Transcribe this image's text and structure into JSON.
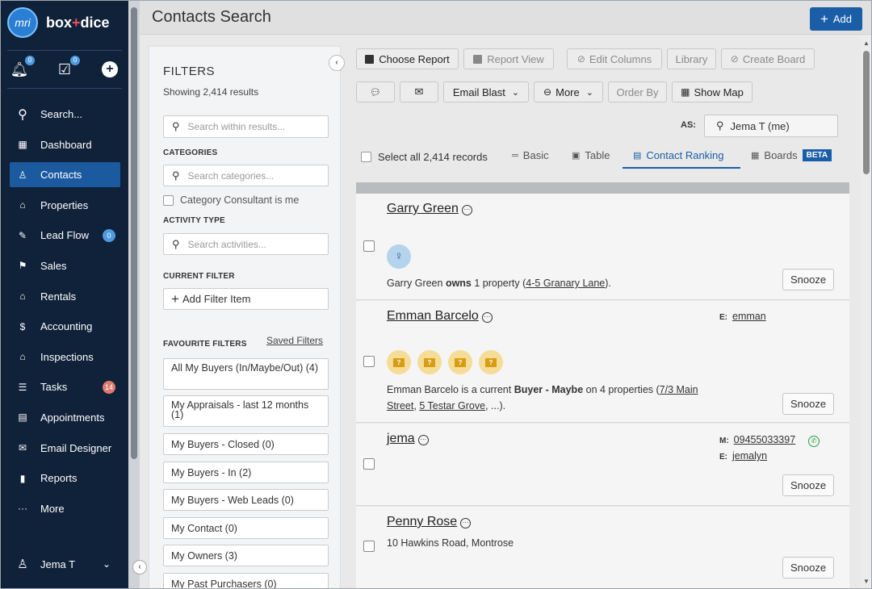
{
  "brand": {
    "logo_text": "mri",
    "name_left": "box",
    "name_plus": "+",
    "name_right": "dice"
  },
  "quick": {
    "notifications_badge": "0",
    "tasks_badge": "0"
  },
  "nav": [
    {
      "label": "Search...",
      "icon": "search-icon"
    },
    {
      "label": "Dashboard",
      "icon": "dashboard-icon"
    },
    {
      "label": "Contacts",
      "icon": "contacts-icon",
      "active": true
    },
    {
      "label": "Properties",
      "icon": "properties-icon"
    },
    {
      "label": "Lead Flow",
      "icon": "lead-flow-icon",
      "badge": "0",
      "badge_color": "#4e9be0"
    },
    {
      "label": "Sales",
      "icon": "sales-icon"
    },
    {
      "label": "Rentals",
      "icon": "rentals-icon"
    },
    {
      "label": "Accounting",
      "icon": "accounting-icon"
    },
    {
      "label": "Inspections",
      "icon": "inspections-icon"
    },
    {
      "label": "Tasks",
      "icon": "tasks-icon",
      "badge": "14",
      "badge_color": "#e07a6e"
    },
    {
      "label": "Appointments",
      "icon": "appointments-icon"
    },
    {
      "label": "Email Designer",
      "icon": "email-icon"
    },
    {
      "label": "Reports",
      "icon": "reports-icon"
    },
    {
      "label": "More",
      "icon": "more-icon"
    }
  ],
  "user": {
    "name": "Jema T"
  },
  "header": {
    "title": "Contacts Search",
    "add_label": "Add"
  },
  "filters": {
    "title": "FILTERS",
    "count": "Showing 2,414 results",
    "search_placeholder": "Search within results...",
    "categories_label": "CATEGORIES",
    "categories_placeholder": "Search categories...",
    "category_consultant": "Category Consultant is me",
    "activity_label": "ACTIVITY TYPE",
    "activity_placeholder": "Search activities...",
    "current_label": "CURRENT FILTER",
    "add_filter": "Add Filter Item",
    "favourite_label": "FAVOURITE FILTERS",
    "saved_link": "Saved Filters",
    "favourites": [
      "All My Buyers (In/Maybe/Out) (4)",
      "My Appraisals - last 12 months (1)",
      "My Buyers - Closed (0)",
      "My Buyers - In (2)",
      "My Buyers - Web Leads (0)",
      "My Contact (0)",
      "My Owners (3)",
      "My Past Purchasers (0)"
    ]
  },
  "toolbar": {
    "choose_report": "Choose Report",
    "report_view": "Report View",
    "edit_columns": "Edit Columns",
    "library": "Library",
    "create_board": "Create Board",
    "email_blast": "Email Blast",
    "more": "More",
    "order_by": "Order By",
    "show_map": "Show Map",
    "as_label": "AS:",
    "as_value": "Jema T (me)"
  },
  "views": {
    "select_all": "Select all 2,414 records",
    "basic": "Basic",
    "table": "Table",
    "ranking": "Contact Ranking",
    "boards": "Boards",
    "beta": "BETA"
  },
  "contacts": {
    "c1": {
      "name": "Garry Green",
      "desc_a": "Garry Green ",
      "desc_b": "owns",
      "desc_c": " 1 property (",
      "desc_link": "4-5 Granary Lane",
      "desc_d": ").",
      "snooze": "Snooze"
    },
    "c2": {
      "name": "Emman Barcelo",
      "email_label": "E:",
      "email": "emman",
      "desc_a": "Emman Barcelo is a current ",
      "desc_b": "Buyer - Maybe",
      "desc_c": " on 4 properties (",
      "link1": "7/3 Main Street",
      "link2": "5 Testar Grove",
      "desc_d": ", ...).",
      "snooze": "Snooze"
    },
    "c3": {
      "name": "jema",
      "mobile_label": "M:",
      "mobile": "09455033397",
      "email_label": "E:",
      "email": "jemalyn",
      "snooze": "Snooze"
    },
    "c4": {
      "name": "Penny Rose",
      "address": "10 Hawkins Road, Montrose",
      "snooze": "Snooze"
    }
  }
}
